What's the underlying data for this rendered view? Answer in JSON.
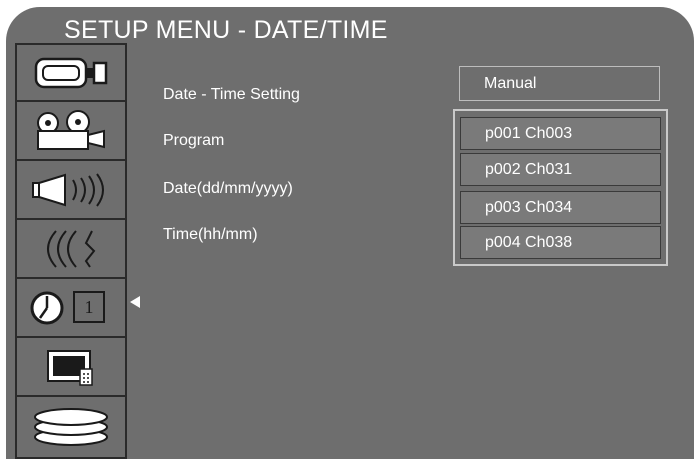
{
  "title": "SETUP MENU - DATE/TIME",
  "sidebar": {
    "items": [
      {
        "name": "camera",
        "icon": "camcorder-icon"
      },
      {
        "name": "projector",
        "icon": "film-projector-icon"
      },
      {
        "name": "audio",
        "icon": "speaker-icon"
      },
      {
        "name": "signal",
        "icon": "signal-wave-icon"
      },
      {
        "name": "clock",
        "icon": "clock-icon",
        "badge": "1",
        "selected": true
      },
      {
        "name": "tv",
        "icon": "tv-icon"
      },
      {
        "name": "discs",
        "icon": "disc-stack-icon"
      }
    ]
  },
  "settings": [
    {
      "label": "Date - Time Setting"
    },
    {
      "label": "Program"
    },
    {
      "label": "Date(dd/mm/yyyy)"
    },
    {
      "label": "Time(hh/mm)"
    }
  ],
  "value": "Manual",
  "dropdown": {
    "options": [
      "p001 Ch003",
      "p002 Ch031",
      "p003 Ch034",
      "p004 Ch038"
    ]
  },
  "colors": {
    "background": "#6e6e6e",
    "text": "#ffffff",
    "sidebar_bg": "#2a2a2a"
  }
}
